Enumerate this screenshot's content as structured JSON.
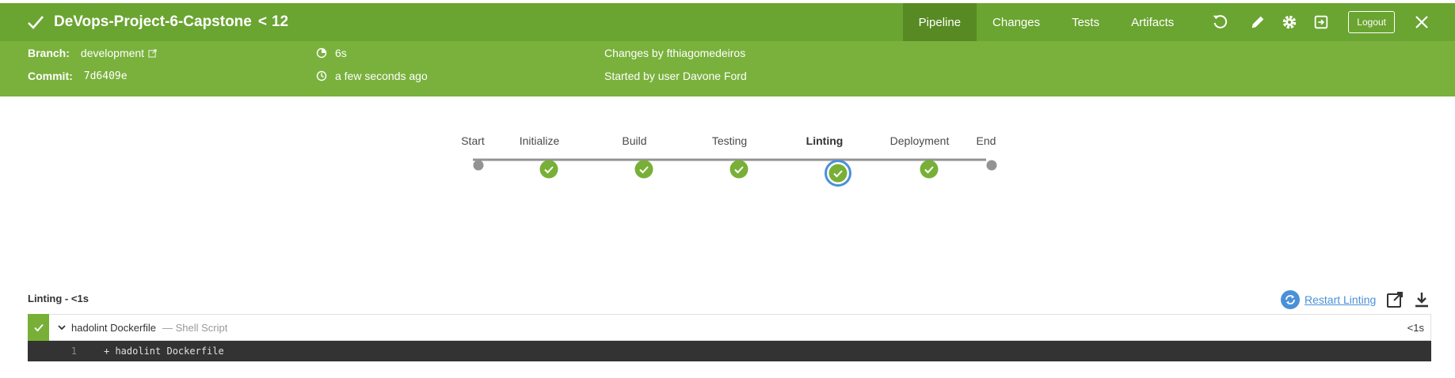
{
  "header": {
    "title": "DeVops-Project-6-Capstone",
    "back_symbol": "<",
    "run_number": "12",
    "tabs": [
      {
        "label": "Pipeline",
        "active": true
      },
      {
        "label": "Changes",
        "active": false
      },
      {
        "label": "Tests",
        "active": false
      },
      {
        "label": "Artifacts",
        "active": false
      }
    ],
    "logout_label": "Logout",
    "icons": [
      "replay-icon",
      "edit-icon",
      "gear-icon",
      "exit-icon",
      "close-icon"
    ]
  },
  "info": {
    "branch_label": "Branch:",
    "branch_value": "development",
    "commit_label": "Commit:",
    "commit_value": "7d6409e",
    "duration": "6s",
    "started_ago": "a few seconds ago",
    "changes_by": "Changes by fthiagomedeiros",
    "started_by": "Started by user Davone Ford"
  },
  "pipeline": {
    "stages": [
      {
        "label": "Start",
        "status": "terminal"
      },
      {
        "label": "Initialize",
        "status": "success"
      },
      {
        "label": "Build",
        "status": "success"
      },
      {
        "label": "Testing",
        "status": "success"
      },
      {
        "label": "Linting",
        "status": "success",
        "selected": true
      },
      {
        "label": "Deployment",
        "status": "success"
      },
      {
        "label": "End",
        "status": "terminal"
      }
    ]
  },
  "detail": {
    "title": "Linting - <1s",
    "restart_label": "Restart Linting",
    "step": {
      "name": "hadolint Dockerfile",
      "type": "— Shell Script",
      "duration": "<1s"
    },
    "log": [
      {
        "line": "1",
        "text": "+ hadolint Dockerfile"
      }
    ]
  },
  "colors": {
    "header_bg": "#6aa431",
    "info_bg": "#79b13c",
    "success": "#78b037",
    "selected_ring": "#4a90d9",
    "link": "#4a90d9"
  }
}
